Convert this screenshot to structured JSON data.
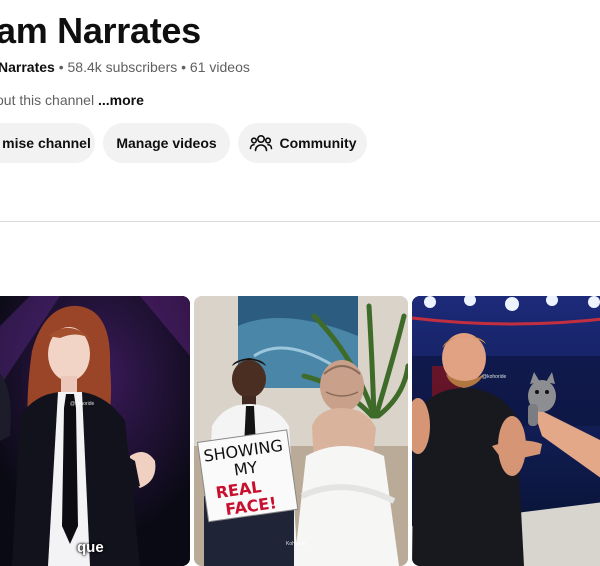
{
  "channel": {
    "name": "am Narrates",
    "handle": "Narrates",
    "sep1": "•",
    "subscribers": "58.4k subscribers",
    "sep2": "•",
    "videos": "61 videos",
    "about": "out this channel",
    "more": "...more"
  },
  "actions": {
    "customise": "mise channel",
    "manage": "Manage videos",
    "community": "Community"
  },
  "thumbnails": [
    {
      "caption": "que",
      "watermark": "@kohoride"
    },
    {
      "sign_lines": [
        "SHOWING",
        "MY",
        "REAL",
        "FACE!"
      ],
      "watermark": "Kohoride"
    },
    {
      "watermark": "@kohoride"
    }
  ],
  "colors": {
    "text": "#0f0f0f",
    "secondary": "#606060",
    "chip_bg": "#f2f2f2",
    "divider": "#d9d9d9"
  }
}
